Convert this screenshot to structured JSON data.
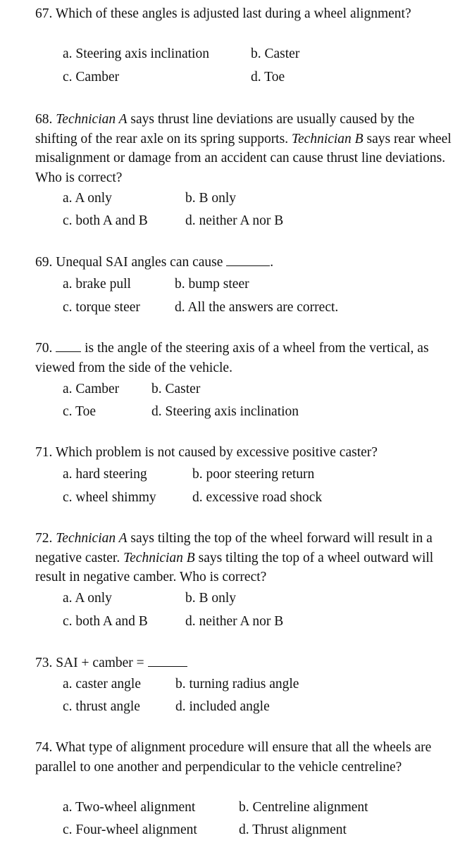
{
  "questions": [
    {
      "number": "67.",
      "text": "Which of these angles is adjusted last during a wheel alignment?",
      "options": {
        "a": "a. Steering axis inclination",
        "b": "b. Caster",
        "c": "c. Camber",
        "d": "d. Toe"
      }
    },
    {
      "number": "68.",
      "tech_a": "Technician A",
      "text_1": " says thrust line deviations are usually caused by the shifting of the rear axle on its spring supports. ",
      "tech_b": "Technician B",
      "text_2": " says rear wheel misalignment or damage from an accident can cause thrust line deviations. Who is correct?",
      "options": {
        "a": "a. A only",
        "b": "b. B only",
        "c": "c. both A and B",
        "d": "d. neither A nor B"
      }
    },
    {
      "number": "69.",
      "text": "Unequal SAI angles can cause",
      "end": ".",
      "options": {
        "a": "a. brake pull",
        "b": "b. bump steer",
        "c": "c. torque steer",
        "d": "d. All the answers are correct."
      }
    },
    {
      "number": "70.",
      "text": "is the angle of the steering axis of a wheel from the vertical, as viewed from the side of the vehicle.",
      "options": {
        "a": "a. Camber",
        "b": "b. Caster",
        "c": "c. Toe",
        "d": "d. Steering axis inclination"
      }
    },
    {
      "number": "71.",
      "text": "Which problem is not caused by excessive positive caster?",
      "options": {
        "a": "a. hard steering",
        "b": "b. poor steering return",
        "c": "c. wheel shimmy",
        "d": "d. excessive road shock"
      }
    },
    {
      "number": "72.",
      "tech_a": "Technician A",
      "text_1": " says tilting the top of the wheel forward will result in a negative caster. ",
      "tech_b": "Technician B",
      "text_2": " says tilting the top of a wheel outward will result in negative camber. Who is correct?",
      "options": {
        "a": "a. A only",
        "b": "b. B only",
        "c": "c. both A and B",
        "d": "d. neither A nor B"
      }
    },
    {
      "number": "73.",
      "text": "SAI + camber =",
      "options": {
        "a": "a. caster angle",
        "b": "b. turning radius angle",
        "c": "c. thrust angle",
        "d": "d. included angle"
      }
    },
    {
      "number": "74.",
      "text": "What type of alignment procedure will ensure that all the wheels are parallel to one another and perpendicular to the vehicle centreline?",
      "options": {
        "a": "a. Two-wheel alignment",
        "b": "b. Centreline alignment",
        "c": "c. Four-wheel alignment",
        "d": "d. Thrust alignment"
      }
    }
  ]
}
